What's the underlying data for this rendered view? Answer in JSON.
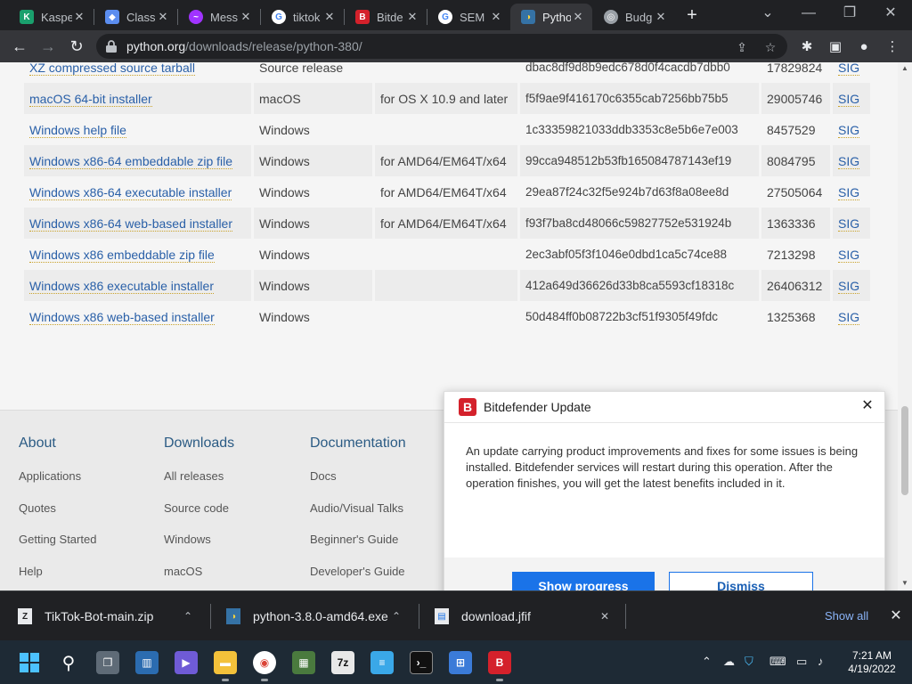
{
  "browser": {
    "tabs": [
      {
        "label": "Kaspe",
        "favicon": "kaspersky-icon",
        "color": "#1aa06d",
        "active": false
      },
      {
        "label": "Class",
        "favicon": "classroom-icon",
        "color": "#5b8def",
        "active": false
      },
      {
        "label": "Mess",
        "favicon": "messenger-icon",
        "color": "#a033ff",
        "active": false
      },
      {
        "label": "tiktok",
        "favicon": "google-icon",
        "color": "#4285f4",
        "active": false
      },
      {
        "label": "Bitde",
        "favicon": "bitdefender-icon",
        "color": "#d4212b",
        "active": false
      },
      {
        "label": "SEM",
        "favicon": "google-icon",
        "color": "#4285f4",
        "active": false
      },
      {
        "label": "Pytho",
        "favicon": "python-icon",
        "color": "#3572a5",
        "active": true
      },
      {
        "label": "Budg",
        "favicon": "globe-icon",
        "color": "#9aa0a6",
        "active": false
      }
    ],
    "tab_close_glyph": "✕",
    "new_tab_glyph": "+",
    "url_host": "python.org",
    "url_path": "/downloads/release/python-380/"
  },
  "downloads_table": {
    "rows": [
      {
        "name": "XZ compressed source tarball",
        "os": "Source release",
        "description": "",
        "md5": "dbac8df9d8b9edc678d0f4cacdb7dbb0",
        "size": "17829824",
        "sig": "SIG"
      },
      {
        "name": "macOS 64-bit installer",
        "os": "macOS",
        "description": "for OS X 10.9 and later",
        "md5": "f5f9ae9f416170c6355cab7256bb75b5",
        "size": "29005746",
        "sig": "SIG"
      },
      {
        "name": "Windows help file",
        "os": "Windows",
        "description": "",
        "md5": "1c33359821033ddb3353c8e5b6e7e003",
        "size": "8457529",
        "sig": "SIG"
      },
      {
        "name": "Windows x86-64 embeddable zip file",
        "os": "Windows",
        "description": "for AMD64/EM64T/x64",
        "md5": "99cca948512b53fb165084787143ef19",
        "size": "8084795",
        "sig": "SIG"
      },
      {
        "name": "Windows x86-64 executable installer",
        "os": "Windows",
        "description": "for AMD64/EM64T/x64",
        "md5": "29ea87f24c32f5e924b7d63f8a08ee8d",
        "size": "27505064",
        "sig": "SIG"
      },
      {
        "name": "Windows x86-64 web-based installer",
        "os": "Windows",
        "description": "for AMD64/EM64T/x64",
        "md5": "f93f7ba8cd48066c59827752e531924b",
        "size": "1363336",
        "sig": "SIG"
      },
      {
        "name": "Windows x86 embeddable zip file",
        "os": "Windows",
        "description": "",
        "md5": "2ec3abf05f3f1046e0dbd1ca5c74ce88",
        "size": "7213298",
        "sig": "SIG"
      },
      {
        "name": "Windows x86 executable installer",
        "os": "Windows",
        "description": "",
        "md5": "412a649d36626d33b8ca5593cf18318c",
        "size": "26406312",
        "sig": "SIG"
      },
      {
        "name": "Windows x86 web-based installer",
        "os": "Windows",
        "description": "",
        "md5": "50d484ff0b08722b3cf51f9305f49fdc",
        "size": "1325368",
        "sig": "SIG"
      }
    ]
  },
  "footer": {
    "columns": [
      {
        "heading": "About",
        "links": [
          "Applications",
          "Quotes",
          "Getting Started",
          "Help"
        ]
      },
      {
        "heading": "Downloads",
        "links": [
          "All releases",
          "Source code",
          "Windows",
          "macOS"
        ]
      },
      {
        "heading": "Documentation",
        "links": [
          "Docs",
          "Audio/Visual Talks",
          "Beginner's Guide",
          "Developer's Guide"
        ]
      }
    ]
  },
  "popup": {
    "title": "Bitdefender Update",
    "logo_letter": "B",
    "close_glyph": "✕",
    "body": "An update carrying product improvements and fixes for some issues is being installed. Bitdefender services will restart during this operation. After the operation finishes, you will get the latest benefits included in it.",
    "primary_button": "Show progress",
    "secondary_button": "Dismiss",
    "brand_color": "#d4212b"
  },
  "download_shelf": {
    "items": [
      {
        "name": "TikTok-Bot-main.zip",
        "icon": "zip-file-icon"
      },
      {
        "name": "python-3.8.0-amd64.exe",
        "icon": "python-installer-icon"
      },
      {
        "name": "download.jfif",
        "icon": "image-file-icon"
      }
    ],
    "show_all": "Show all",
    "close_glyph": "✕"
  },
  "taskbar": {
    "time": "7:21 AM",
    "date": "4/19/2022"
  }
}
